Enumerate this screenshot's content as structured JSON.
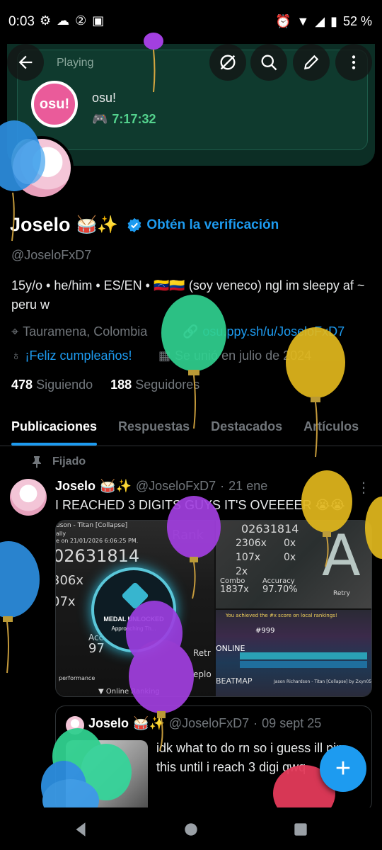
{
  "status": {
    "time": "0:03",
    "left_icons": [
      "gear-icon",
      "cloud-icon",
      "badge-2-icon",
      "sim-icon"
    ],
    "battery": "52 %"
  },
  "banner": {
    "now_playing": "Playing",
    "game_name": "osu!",
    "game_logo_text": "osu!",
    "play_time": "7:17:32"
  },
  "profile": {
    "name": "Joselo",
    "name_emoji": "🥁✨",
    "verify_label": "Obtén la verificación",
    "handle": "@JoseloFxD7",
    "bio": "15y/o • he/him • ES/EN • 🇻🇪🇨🇴 (soy veneco) ngl im sleepy af ~ peru w",
    "location": "Tauramena, Colombia",
    "website": "osu.ppy.sh/u/JoseloFxD7",
    "birthday": "¡Feliz cumpleaños!",
    "joined": "Se unió en julio de 2024",
    "following_count": "478",
    "following_label": "Siguiendo",
    "followers_count": "188",
    "followers_label": "Seguidores"
  },
  "tabs": [
    {
      "label": "Publicaciones",
      "active": true
    },
    {
      "label": "Respuestas",
      "active": false
    },
    {
      "label": "Destacados",
      "active": false
    },
    {
      "label": "Artículos",
      "active": false
    }
  ],
  "tweet": {
    "pinned_label": "Fijado",
    "name": "Joselo",
    "name_emoji": "🥁✨",
    "handle": "@JoseloFxD7",
    "separator": "·",
    "date": "21 ene",
    "text": "I REACHED 3 DIGITS GUYS IT'S OVEEEER 😭😭",
    "media": {
      "m1_title": "uson - Titan [Collapse]",
      "m1_sub": "ally",
      "m1_played": "e on 21/01/2026 6:06:25 PM.",
      "m1_score": "02631814",
      "m1_combo1": "306x",
      "m1_combo2": "07x",
      "m1_acc": "Acc",
      "m1_acc_val": "97",
      "medal_title": "MEDAL UNLOCKED",
      "medal_sub": "Approaching Th...",
      "m1_online": "▼ Online Ranking",
      "m1_retry": "Retr",
      "m1_replay": "eplo",
      "m1_perf": "performance",
      "m1_rank": "Rank",
      "m2_score": "02631814",
      "m2_c1": "2306x",
      "m2_c1b": "0x",
      "m2_c2": "107x",
      "m2_c2b": "0x",
      "m2_c3": "2x",
      "m2_combo_label": "Combo",
      "m2_combo": "1837x",
      "m2_acc_label": "Accuracy",
      "m2_acc": "97.70%",
      "m2_retry": "Retry",
      "m3_banner": "You achieved the #x score on local rankings!",
      "m3_rank": "#999",
      "m3_online": "ONLINE",
      "m3_beatmap": "BEATMAP",
      "m3_map": "Jason Richardson - Titan [Collapse] by Zxyn05"
    }
  },
  "quote": {
    "name": "Joselo",
    "name_emoji": "🥁✨",
    "handle": "@JoseloFxD7",
    "separator": "·",
    "date": "09 sept 25",
    "text": "idk what to do rn so i guess ill pin this until i reach 3 digi qwq"
  },
  "fab_label": "+",
  "colors": {
    "accent": "#1d9bf0",
    "banner_bg": "#0c2e25",
    "game_time": "#54d38e",
    "osu_pink": "#ea5b9a"
  }
}
